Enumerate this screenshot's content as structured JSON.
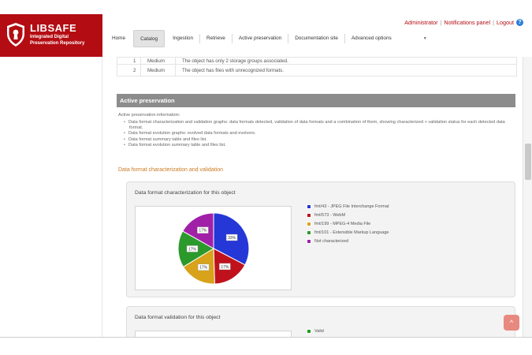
{
  "logo": {
    "brand": "LIBSAFE",
    "subtitle_lines": [
      "Integrated Digital",
      "Preservation Repository"
    ]
  },
  "top_links": {
    "user": "Administrator",
    "notifications": "Notifications panel",
    "logout": "Logout",
    "help": "?"
  },
  "nav": {
    "items": [
      "Home",
      "Catalog",
      "Ingestion",
      "Retrieve",
      "Active preservation",
      "Documentation site",
      "Advanced options"
    ],
    "active": "Catalog"
  },
  "files_table": {
    "rows": [
      {
        "num": "1",
        "level": "Medium",
        "message": "The object has only 2 storage groups associated."
      },
      {
        "num": "2",
        "level": "Medium",
        "message": "The object has files with unrecognized formats."
      }
    ]
  },
  "active_preservation": {
    "header": "Active preservation",
    "intro": "Active preservation information:",
    "items": [
      "Data format characterization and validation graphs: data formats detected, validation of data formats and a combination of them, showing characterized + validation status for each detected data format.",
      "Data format evolution graphs: evolved data formats and evolvers.",
      "Data format summary table and files list.",
      "Data format evolution summary table and files list."
    ],
    "section_link": "Data format characterization and validation"
  },
  "characterization_panel": {
    "title": "Data format characterization for this object"
  },
  "validation_panel": {
    "title": "Data format validation for this object",
    "legend": [
      {
        "label": "Valid",
        "color": "#1e9e1e"
      }
    ]
  },
  "chart_data": {
    "type": "pie",
    "title": "Data format characterization for this object",
    "slices": [
      {
        "label": "fmt/43 - JPEG File Interchange Format",
        "value": 33,
        "display": "33%",
        "color": "#2537d6"
      },
      {
        "label": "fmt/573 - WebM",
        "value": 17,
        "display": "17%",
        "color": "#c0121c"
      },
      {
        "label": "fmt/199 - MPEG-4 Media File",
        "value": 17,
        "display": "17%",
        "color": "#d8a21a"
      },
      {
        "label": "fmt/101 - Extensible Markup Language",
        "value": 17,
        "display": "17%",
        "color": "#2b9a2b"
      },
      {
        "label": "Not characterized",
        "value": 17,
        "display": "17%",
        "color": "#a120a8"
      }
    ],
    "legend_position": "right"
  },
  "ui": {
    "to_top": "^"
  }
}
